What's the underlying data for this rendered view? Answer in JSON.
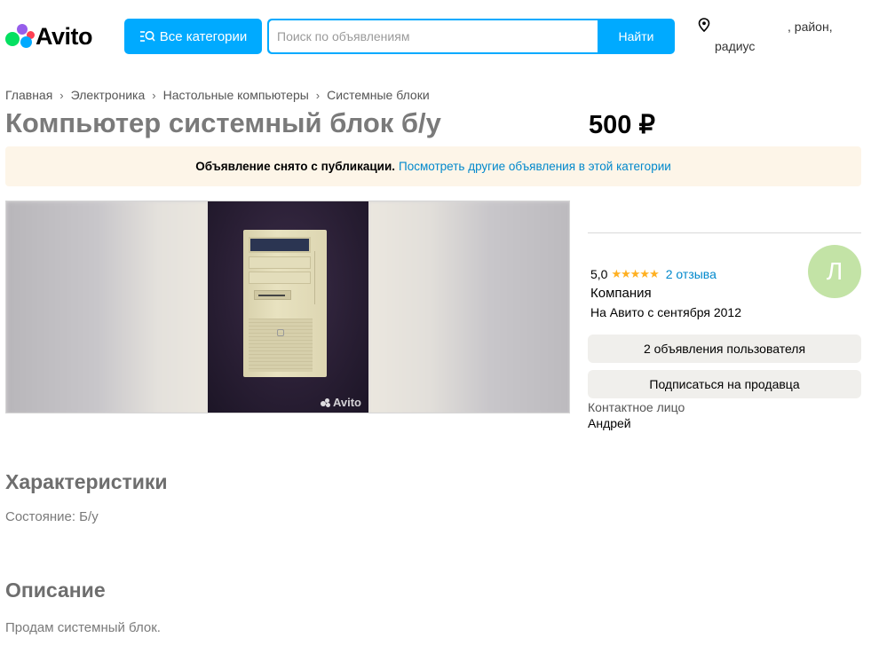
{
  "header": {
    "logo_text": "Avito",
    "categories_label": "Все категории",
    "search_placeholder": "Поиск по объявлениям",
    "search_button": "Найти",
    "location_region": ", район,",
    "location_radius": "радиус"
  },
  "breadcrumbs": [
    "Главная",
    "Электроника",
    "Настольные компьютеры",
    "Системные блоки"
  ],
  "listing": {
    "title": "Компьютер системный блок б/у",
    "price": "500 ₽",
    "banner_strong": "Объявление снято с публикации.",
    "banner_link": "Посмотреть другие объявления в этой категории",
    "photo_watermark": "Avito"
  },
  "seller": {
    "rating": "5,0",
    "stars": "★★★★★",
    "reviews": "2 отзыва",
    "type": "Компания",
    "since": "На Авито с сентября 2012",
    "avatar_letter": "Л",
    "ads_button": "2 объявления пользователя",
    "subscribe_button": "Подписаться на продавца",
    "contact_label": "Контактное лицо",
    "contact_name": "Андрей"
  },
  "characteristics": {
    "heading": "Характеристики",
    "condition": "Состояние: Б/у"
  },
  "description": {
    "heading": "Описание",
    "text": "Продам системный блок."
  },
  "colors": {
    "brand_blue": "#00aaff",
    "link": "#0088cc",
    "banner_bg": "#fdf5e8",
    "star": "#ffb021",
    "avatar_bg": "#c3e3a6"
  }
}
